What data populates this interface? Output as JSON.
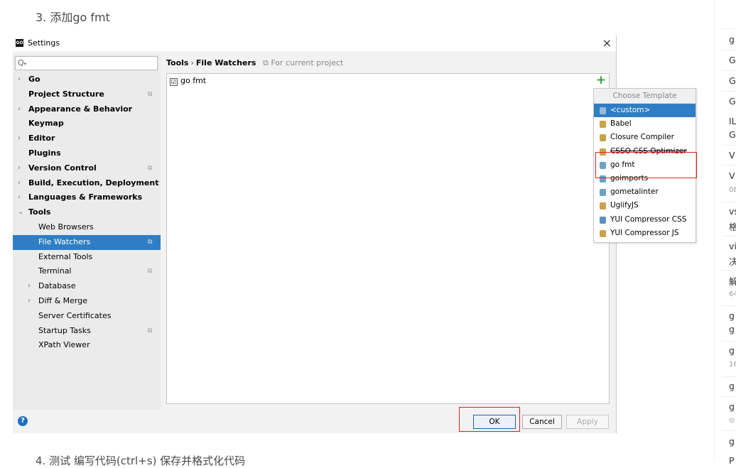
{
  "article": {
    "step3": "3. 添加go fmt",
    "step4": "4. 测试 编写代码(ctrl+s) 保存并格式化代码"
  },
  "dialog": {
    "title": "Settings",
    "app_icon": "GO",
    "close": "×",
    "search_placeholder": "",
    "tree": [
      {
        "label": "Go",
        "arrow": "›",
        "bold": true
      },
      {
        "label": "Project Structure",
        "bold": true,
        "project": true
      },
      {
        "label": "Appearance & Behavior",
        "arrow": "›",
        "bold": true
      },
      {
        "label": "Keymap",
        "bold": true
      },
      {
        "label": "Editor",
        "arrow": "›",
        "bold": true
      },
      {
        "label": "Plugins",
        "bold": true
      },
      {
        "label": "Version Control",
        "arrow": "›",
        "bold": true,
        "project": true
      },
      {
        "label": "Build, Execution, Deployment",
        "arrow": "›",
        "bold": true
      },
      {
        "label": "Languages & Frameworks",
        "arrow": "›",
        "bold": true
      },
      {
        "label": "Tools",
        "arrow": "⌄",
        "bold": true
      },
      {
        "label": "Web Browsers"
      },
      {
        "label": "File Watchers",
        "selected": true,
        "project": true
      },
      {
        "label": "External Tools"
      },
      {
        "label": "Terminal",
        "project": true
      },
      {
        "label": "Database",
        "arrow": "›"
      },
      {
        "label": "Diff & Merge",
        "arrow": "›"
      },
      {
        "label": "Server Certificates"
      },
      {
        "label": "Startup Tasks",
        "project": true
      },
      {
        "label": "XPath Viewer"
      }
    ],
    "breadcrumb": {
      "parent": "Tools",
      "sep": "›",
      "current": "File Watchers",
      "scope": "For current project"
    },
    "watchers": [
      {
        "label": "go fmt",
        "checked": "☑"
      }
    ],
    "add": "+",
    "buttons": {
      "help": "?",
      "ok": "OK",
      "cancel": "Cancel",
      "apply": "Apply"
    },
    "project_icon": "⧉"
  },
  "popup": {
    "title": "Choose Template",
    "items": [
      {
        "label": "<custom>",
        "selected": true,
        "color": "#9bb8d8"
      },
      {
        "label": "Babel",
        "color": "#c9a24a"
      },
      {
        "label": "Closure Compiler",
        "color": "#c9a24a"
      },
      {
        "label": "CSSO CSS Optimizer",
        "color": "#c9a24a",
        "strike": true
      },
      {
        "label": "go fmt",
        "color": "#6aa2c8"
      },
      {
        "label": "goimports",
        "color": "#6aa2c8"
      },
      {
        "label": "gometalinter",
        "color": "#6aa2c8"
      },
      {
        "label": "UglifyJS",
        "color": "#c9a24a"
      },
      {
        "label": "YUI Compressor CSS",
        "color": "#5b8fc2"
      },
      {
        "label": "YUI Compressor JS",
        "color": "#c9a24a"
      }
    ]
  },
  "right_sidebar": {
    "items": [
      "g",
      "G",
      "G",
      "G",
      "IL",
      "G",
      "V",
      "V",
      "08",
      "vs",
      "格",
      "vi",
      "决",
      "解",
      "64",
      "g",
      "g",
      "g",
      "16",
      "g",
      "g",
      "⊙",
      "g",
      "P"
    ]
  },
  "colors": {
    "selection": "#2f7ec4",
    "highlight_box": "#e02020",
    "add": "#3a9a3a"
  }
}
